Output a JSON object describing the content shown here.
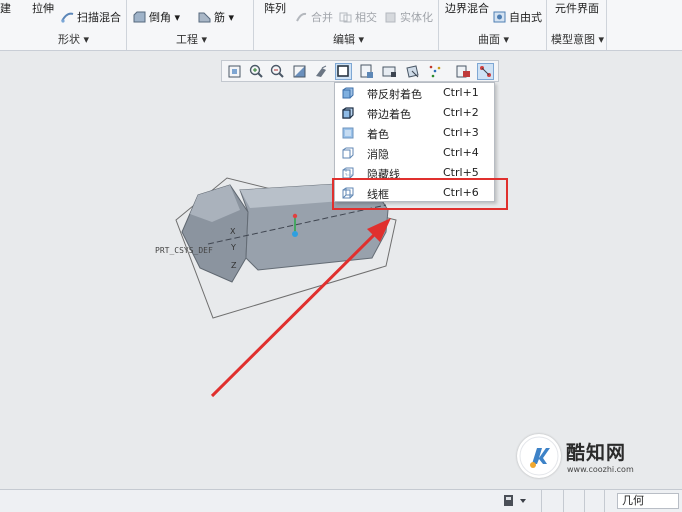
{
  "ribbon": {
    "items": {
      "cut_left": "建",
      "extrude": "拉伸",
      "sweep_blend": "扫描混合",
      "chamfer": "倒角",
      "rib": "筋",
      "pattern": "阵列",
      "merge": "合并",
      "intersect": "相交",
      "solidify": "实体化",
      "boundary_blend": "边界混合",
      "freestyle": "自由式",
      "element_interface": "元件界面"
    },
    "groups": {
      "shapes": "形状",
      "engineering": "工程",
      "editing": "编辑",
      "surfaces": "曲面",
      "model_intent": "模型意图"
    }
  },
  "model": {
    "csys_label": "PRT_CSYS_DEF",
    "axis_x": "X",
    "axis_y": "Y",
    "axis_z": "Z"
  },
  "display_style_menu": {
    "items": [
      {
        "label": "带反射着色",
        "shortcut": "Ctrl+1"
      },
      {
        "label": "带边着色",
        "shortcut": "Ctrl+2"
      },
      {
        "label": "着色",
        "shortcut": "Ctrl+3"
      },
      {
        "label": "消隐",
        "shortcut": "Ctrl+4"
      },
      {
        "label": "隐藏线",
        "shortcut": "Ctrl+5"
      },
      {
        "label": "线框",
        "shortcut": "Ctrl+6"
      }
    ],
    "highlighted_item": "线框"
  },
  "status_bar": {
    "filter_value": "几何"
  },
  "watermark": {
    "title": "酷知网",
    "url": "www.coozhi.com"
  },
  "colors": {
    "annotation_red": "#e0302e",
    "model_gray": "#8e97a3",
    "accent_blue": "#3d82c7"
  }
}
